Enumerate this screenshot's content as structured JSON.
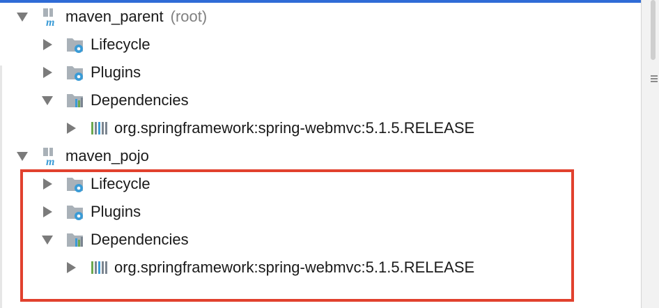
{
  "tree": {
    "projects": [
      {
        "name": "maven_parent",
        "suffix": "(root)",
        "children": [
          {
            "label": "Lifecycle"
          },
          {
            "label": "Plugins"
          },
          {
            "label": "Dependencies",
            "dependency": "org.springframework:spring-webmvc:5.1.5.RELEASE"
          }
        ]
      },
      {
        "name": "maven_pojo",
        "children": [
          {
            "label": "Lifecycle"
          },
          {
            "label": "Plugins"
          },
          {
            "label": "Dependencies",
            "dependency": "org.springframework:spring-webmvc:5.1.5.RELEASE"
          }
        ]
      }
    ]
  },
  "icons": {
    "project": "maven-project-icon",
    "lifecycle": "lifecycle-folder-icon",
    "plugins": "plugins-folder-icon",
    "dependencies": "dependencies-folder-icon",
    "library": "library-icon",
    "expanded": "expanded-arrow-icon",
    "collapsed": "collapsed-arrow-icon"
  },
  "colors": {
    "highlight_border": "#e1412e",
    "top_accent": "#2f6bd6",
    "folder_gray": "#a9b1b8",
    "gear_blue": "#3a9bd6"
  }
}
